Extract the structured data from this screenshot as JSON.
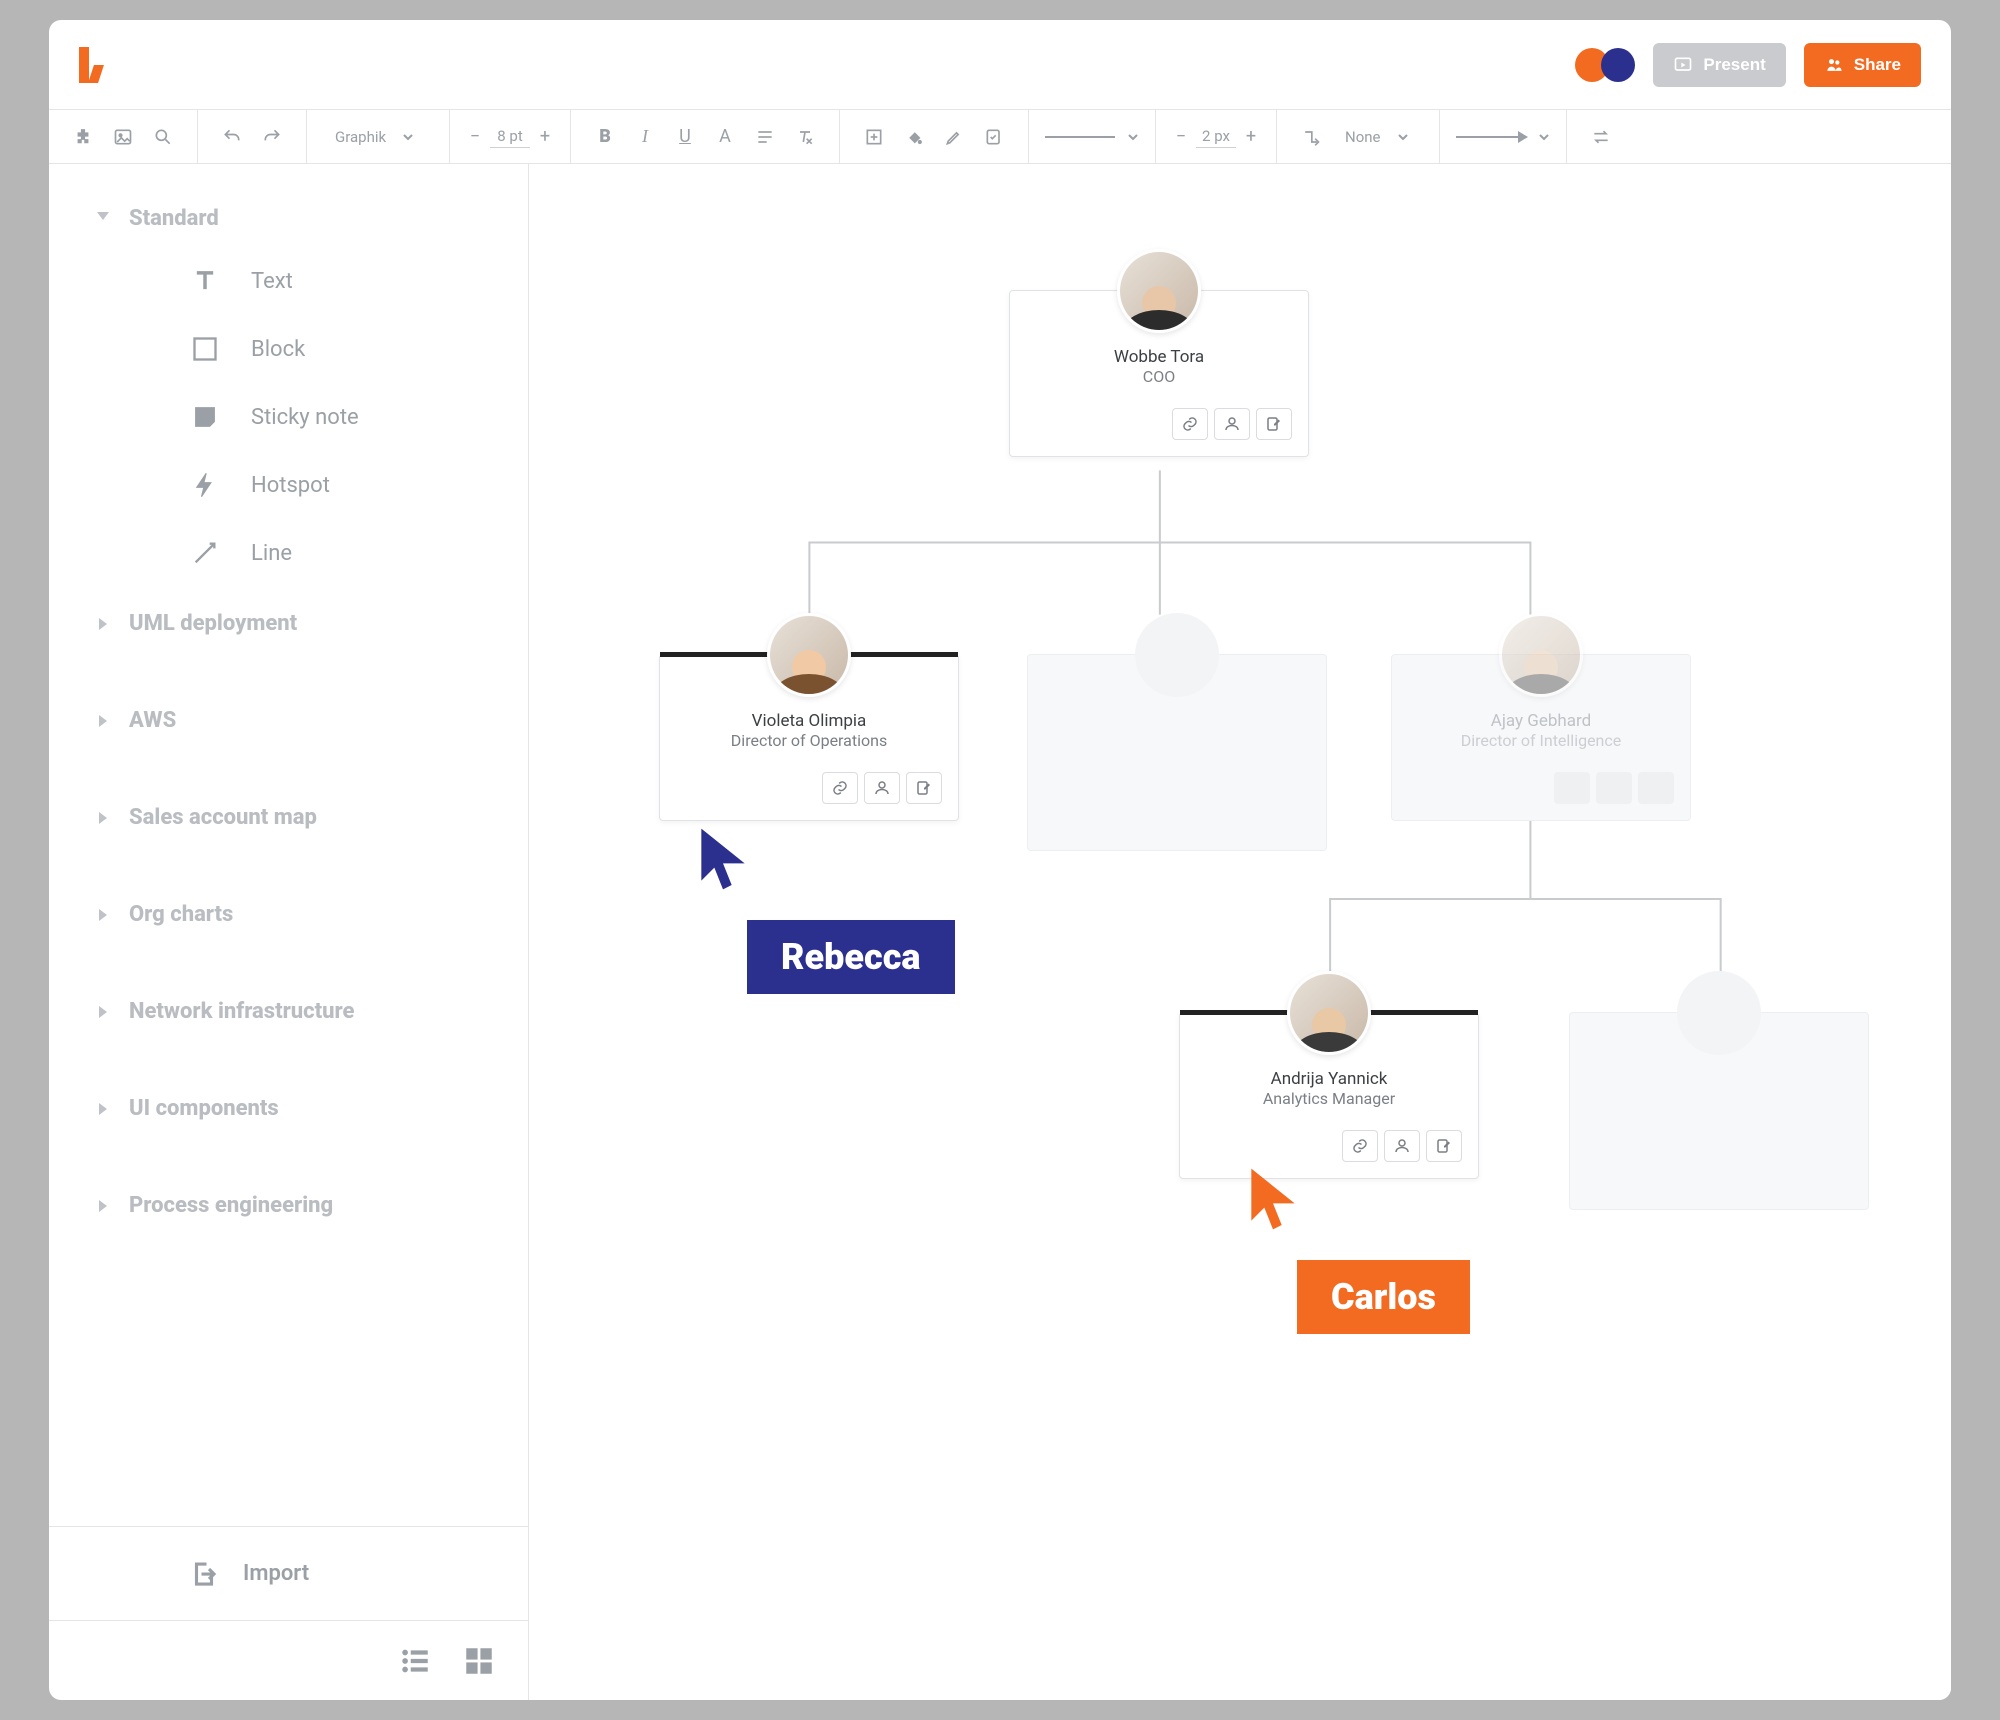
{
  "titlebar": {
    "present_label": "Present",
    "share_label": "Share",
    "presence_colors": {
      "user1": "#f26b21",
      "user2": "#2b2f8e"
    }
  },
  "toolbar": {
    "font_family": "Graphik",
    "font_size": "8 pt",
    "stroke_width": "2 px",
    "line_end_label": "None"
  },
  "sidebar": {
    "sections": [
      {
        "id": "standard",
        "label": "Standard",
        "open": true
      },
      {
        "id": "uml",
        "label": "UML deployment",
        "open": false
      },
      {
        "id": "aws",
        "label": "AWS",
        "open": false
      },
      {
        "id": "sales",
        "label": "Sales account map",
        "open": false
      },
      {
        "id": "org",
        "label": "Org charts",
        "open": false
      },
      {
        "id": "network",
        "label": "Network infrastructure",
        "open": false
      },
      {
        "id": "ui",
        "label": "UI components",
        "open": false
      },
      {
        "id": "process",
        "label": "Process engineering",
        "open": false
      }
    ],
    "standard_shapes": [
      {
        "id": "text",
        "label": "Text"
      },
      {
        "id": "block",
        "label": "Block"
      },
      {
        "id": "sticky",
        "label": "Sticky note"
      },
      {
        "id": "hotspot",
        "label": "Hotspot"
      },
      {
        "id": "line",
        "label": "Line"
      }
    ],
    "import_label": "Import"
  },
  "canvas": {
    "nodes": {
      "root": {
        "name": "Wobbe Tora",
        "role": "COO"
      },
      "left": {
        "name": "Violeta Olimpia",
        "role": "Director of Operations"
      },
      "right": {
        "name": "Ajay Gebhard",
        "role": "Director of Intelligence"
      },
      "child": {
        "name": "Andrija Yannick",
        "role": "Analytics Manager"
      }
    },
    "cursors": {
      "rebecca": "Rebecca",
      "carlos": "Carlos"
    }
  }
}
